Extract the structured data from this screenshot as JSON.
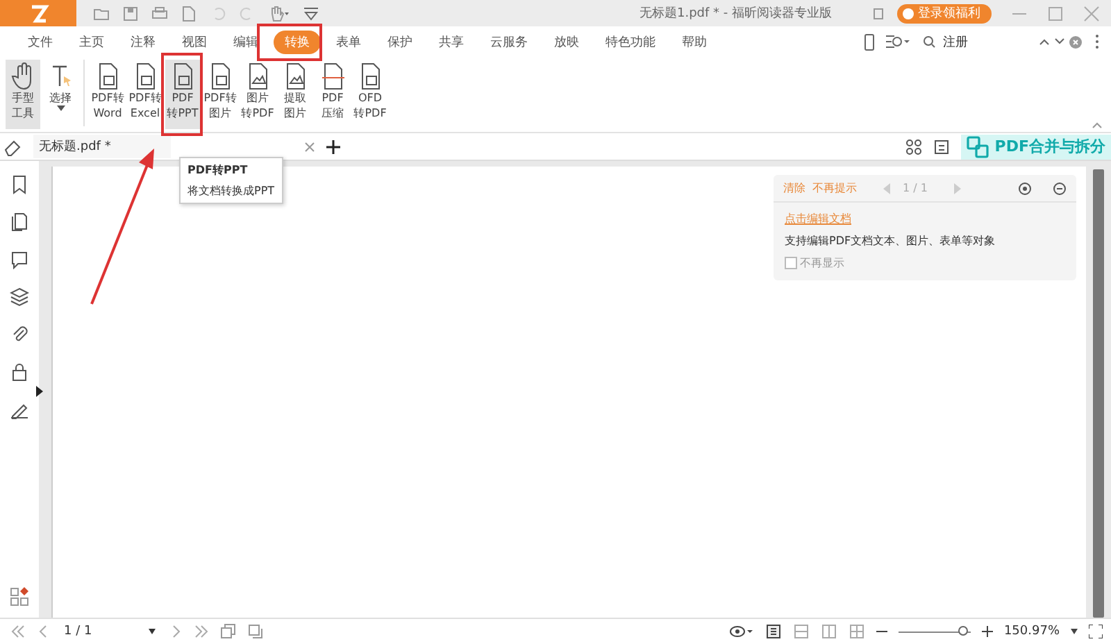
{
  "window": {
    "title": "无标题1.pdf * - 福昕阅读器专业版",
    "login_button": "登录领福利"
  },
  "menu_tabs": [
    {
      "label": "文件",
      "selected": false
    },
    {
      "label": "主页",
      "selected": false
    },
    {
      "label": "注释",
      "selected": false
    },
    {
      "label": "视图",
      "selected": false
    },
    {
      "label": "编辑",
      "selected": false
    },
    {
      "label": "转换",
      "selected": true
    },
    {
      "label": "表单",
      "selected": false
    },
    {
      "label": "保护",
      "selected": false
    },
    {
      "label": "共享",
      "selected": false
    },
    {
      "label": "云服务",
      "selected": false
    },
    {
      "label": "放映",
      "selected": false
    },
    {
      "label": "特色功能",
      "selected": false
    },
    {
      "label": "帮助",
      "selected": false
    }
  ],
  "search": {
    "value": "注册"
  },
  "ribbon": [
    {
      "kind": "hand",
      "lines": [
        "手型",
        "工具"
      ],
      "selected": true
    },
    {
      "kind": "select",
      "lines": [
        "选择"
      ],
      "selected": false
    },
    {
      "kind": "doc",
      "lines": [
        "PDF转",
        "Word"
      ],
      "selected": false
    },
    {
      "kind": "doc",
      "lines": [
        "PDF转",
        "Excel"
      ],
      "selected": false
    },
    {
      "kind": "doc",
      "lines": [
        "PDF",
        "转PPT"
      ],
      "selected": true
    },
    {
      "kind": "doc",
      "lines": [
        "PDF转",
        "图片"
      ],
      "selected": false
    },
    {
      "kind": "image",
      "lines": [
        "图片",
        "转PDF"
      ],
      "selected": false
    },
    {
      "kind": "image",
      "lines": [
        "提取",
        "图片"
      ],
      "selected": false
    },
    {
      "kind": "zip",
      "lines": [
        "PDF",
        "压缩"
      ],
      "selected": false
    },
    {
      "kind": "doc",
      "lines": [
        "OFD",
        "转PDF"
      ],
      "selected": false
    }
  ],
  "doc_tab": {
    "label": "无标题.pdf *"
  },
  "tooltip": {
    "title": "PDF转PPT",
    "text": "将文档转换成PPT"
  },
  "promo": {
    "label": "PDF合并与拆分"
  },
  "panel": {
    "clear": "清除",
    "dismiss": "不再提示",
    "page": "1 / 1",
    "link": "点击编辑文档",
    "description": "支持编辑PDF文档文本、图片、表单等对象",
    "checkbox": {
      "label": "不再显示",
      "checked": false
    }
  },
  "status_bar": {
    "page": "1 / 1",
    "zoom": "150.97%",
    "zoom_slider": {
      "level": 0.9
    }
  }
}
